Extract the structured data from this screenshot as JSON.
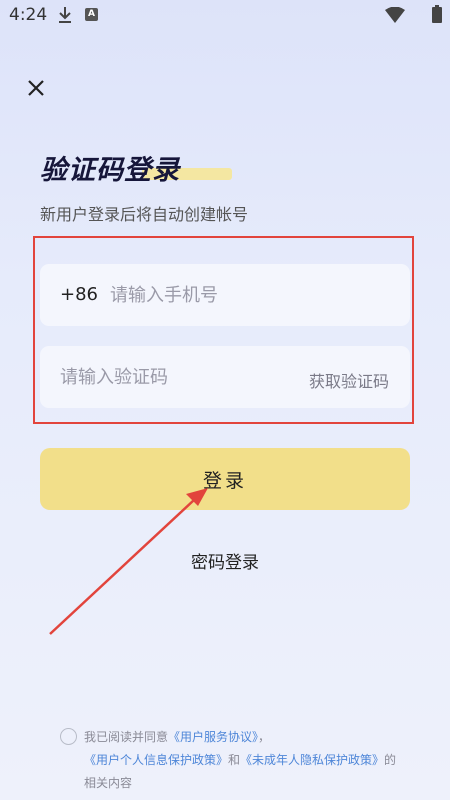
{
  "status_bar": {
    "time": "4:24",
    "icons": [
      "download-icon",
      "a-icon",
      "wifi-icon",
      "battery-icon"
    ],
    "a_glyph": "A"
  },
  "header": {
    "close_icon": "close-icon"
  },
  "page": {
    "title": "验证码登录",
    "subtitle": "新用户登录后将自动创建帐号"
  },
  "form": {
    "country_code": "+86",
    "phone_placeholder": "请输入手机号",
    "phone_value": "",
    "code_placeholder": "请输入验证码",
    "code_value": "",
    "get_code_label": "获取验证码"
  },
  "actions": {
    "login_label": "登录",
    "password_login_label": "密码登录"
  },
  "agreement": {
    "checked": false,
    "prefix": "我已阅读并同意",
    "user_service": "《用户服务协议》",
    "sep1": "，",
    "personal_info": "《用户个人信息保护政策》",
    "and": "和",
    "minor_privacy": "《未成年人隐私保护政策》",
    "suffix": "的相关内容"
  },
  "colors": {
    "login_button_bg": "#f2df8a",
    "link": "#4e86d8",
    "annotation_red": "#e2443c"
  }
}
